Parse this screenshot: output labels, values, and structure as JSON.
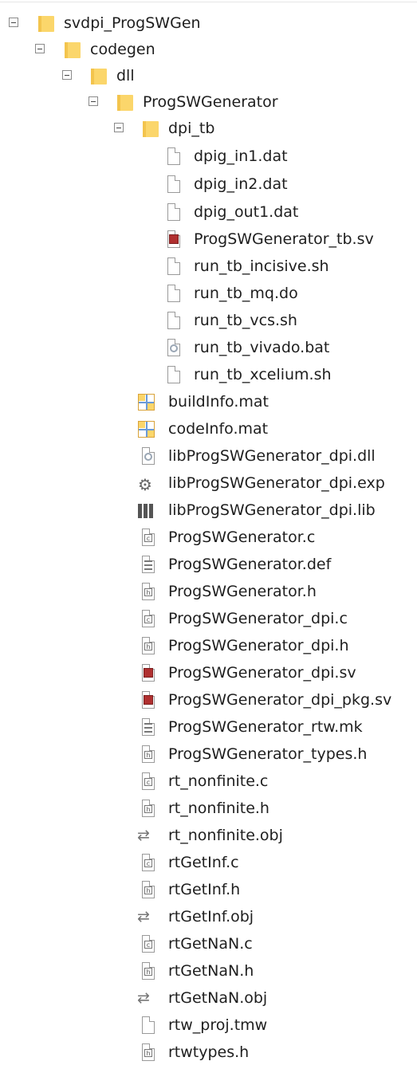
{
  "tree": [
    {
      "label": "svdpi_ProgSWGen",
      "icon": "folder-icon",
      "expanded": true
    },
    {
      "label": "codegen",
      "icon": "folder-icon",
      "expanded": true
    },
    {
      "label": "dll",
      "icon": "folder-icon",
      "expanded": true
    },
    {
      "label": "ProgSWGenerator",
      "icon": "folder-icon",
      "expanded": true
    },
    {
      "label": "dpi_tb",
      "icon": "folder-icon",
      "expanded": true
    },
    {
      "label": "dpig_in1.dat",
      "icon": "file-icon"
    },
    {
      "label": "dpig_in2.dat",
      "icon": "file-icon"
    },
    {
      "label": "dpig_out1.dat",
      "icon": "file-icon"
    },
    {
      "label": "ProgSWGenerator_tb.sv",
      "icon": "sv-file-icon"
    },
    {
      "label": "run_tb_incisive.sh",
      "icon": "file-icon"
    },
    {
      "label": "run_tb_mq.do",
      "icon": "file-icon"
    },
    {
      "label": "run_tb_vcs.sh",
      "icon": "file-icon"
    },
    {
      "label": "run_tb_vivado.bat",
      "icon": "bat-file-icon"
    },
    {
      "label": "run_tb_xcelium.sh",
      "icon": "file-icon"
    },
    {
      "label": "buildInfo.mat",
      "icon": "mat-file-icon"
    },
    {
      "label": "codeInfo.mat",
      "icon": "mat-file-icon"
    },
    {
      "label": "libProgSWGenerator_dpi.dll",
      "icon": "dll-file-icon"
    },
    {
      "label": "libProgSWGenerator_dpi.exp",
      "icon": "exp-file-icon"
    },
    {
      "label": "libProgSWGenerator_dpi.lib",
      "icon": "lib-file-icon"
    },
    {
      "label": "ProgSWGenerator.c",
      "icon": "c-file-icon"
    },
    {
      "label": "ProgSWGenerator.def",
      "icon": "def-file-icon"
    },
    {
      "label": "ProgSWGenerator.h",
      "icon": "h-file-icon"
    },
    {
      "label": "ProgSWGenerator_dpi.c",
      "icon": "c-file-icon"
    },
    {
      "label": "ProgSWGenerator_dpi.h",
      "icon": "h-file-icon"
    },
    {
      "label": "ProgSWGenerator_dpi.sv",
      "icon": "sv-file-icon"
    },
    {
      "label": "ProgSWGenerator_dpi_pkg.sv",
      "icon": "sv-file-icon"
    },
    {
      "label": "ProgSWGenerator_rtw.mk",
      "icon": "mk-file-icon"
    },
    {
      "label": "ProgSWGenerator_types.h",
      "icon": "h-file-icon"
    },
    {
      "label": "rt_nonfinite.c",
      "icon": "c-file-icon"
    },
    {
      "label": "rt_nonfinite.h",
      "icon": "h-file-icon"
    },
    {
      "label": "rt_nonfinite.obj",
      "icon": "obj-file-icon"
    },
    {
      "label": "rtGetInf.c",
      "icon": "c-file-icon"
    },
    {
      "label": "rtGetInf.h",
      "icon": "h-file-icon"
    },
    {
      "label": "rtGetInf.obj",
      "icon": "obj-file-icon"
    },
    {
      "label": "rtGetNaN.c",
      "icon": "c-file-icon"
    },
    {
      "label": "rtGetNaN.h",
      "icon": "h-file-icon"
    },
    {
      "label": "rtGetNaN.obj",
      "icon": "obj-file-icon"
    },
    {
      "label": "rtw_proj.tmw",
      "icon": "file-icon"
    },
    {
      "label": "rtwtypes.h",
      "icon": "h-file-icon"
    }
  ],
  "colors": {
    "folder": "#fbd66b",
    "sv": "#b03030",
    "text": "#1e1e1e"
  }
}
